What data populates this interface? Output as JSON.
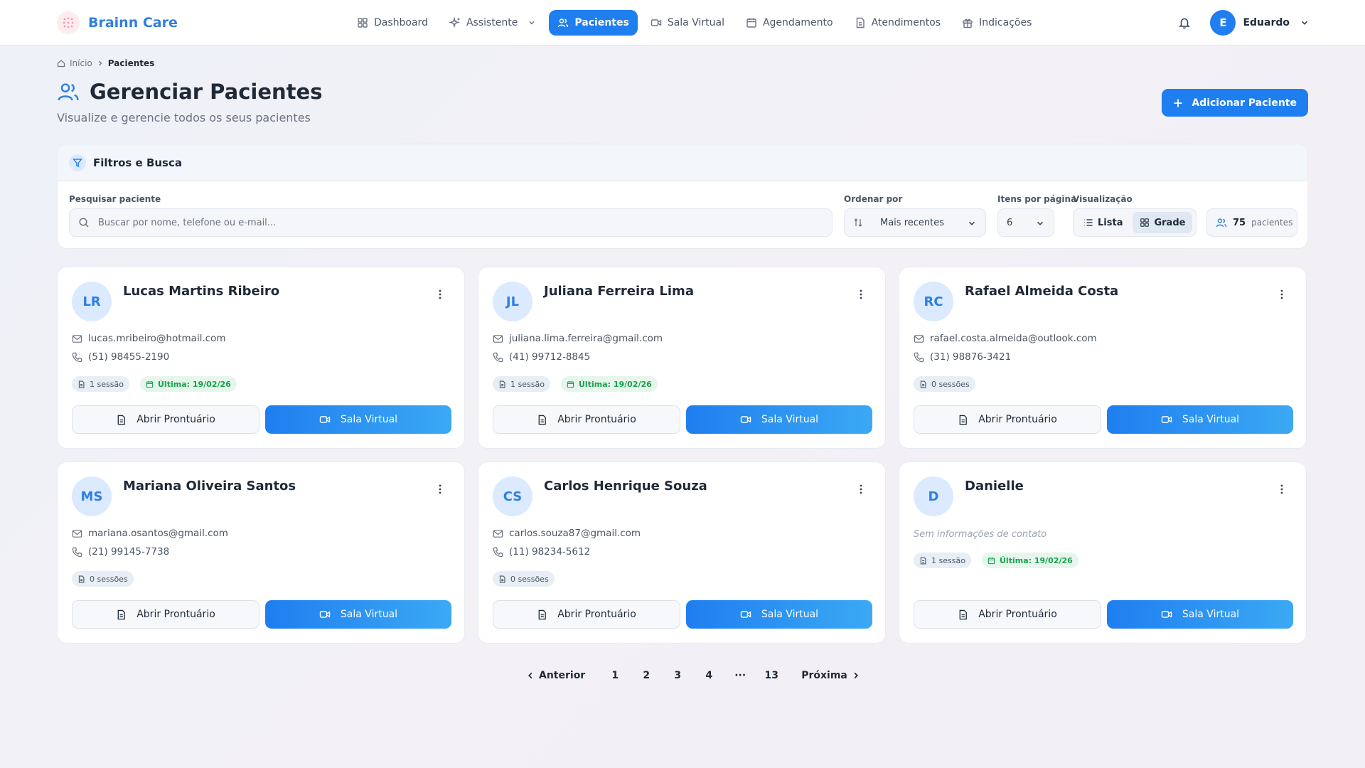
{
  "brand": {
    "name": "Brainn Care"
  },
  "nav": {
    "items": [
      {
        "label": "Dashboard",
        "icon": "grid-icon"
      },
      {
        "label": "Assistente",
        "icon": "sparkles-icon"
      },
      {
        "label": "Pacientes",
        "icon": "users-icon",
        "active": true
      },
      {
        "label": "Sala Virtual",
        "icon": "video-icon"
      },
      {
        "label": "Agendamento",
        "icon": "calendar-icon"
      },
      {
        "label": "Atendimentos",
        "icon": "document-icon"
      },
      {
        "label": "Indicações",
        "icon": "gift-icon"
      }
    ]
  },
  "user": {
    "initial": "E",
    "name": "Eduardo"
  },
  "breadcrumb": {
    "home": "Início",
    "current": "Pacientes"
  },
  "header": {
    "title": "Gerenciar Pacientes",
    "subtitle": "Visualize e gerencie todos os seus pacientes",
    "add_button": "Adicionar Paciente"
  },
  "filters": {
    "title": "Filtros e Busca",
    "search_label": "Pesquisar paciente",
    "search_placeholder": "Buscar por nome, telefone ou e-mail...",
    "order_label": "Ordenar por",
    "order_value": "Mais recentes",
    "per_page_label": "Itens por página",
    "per_page_value": "6",
    "view_label": "Visualização",
    "view_list": "Lista",
    "view_grid": "Grade",
    "count": "75",
    "count_label": "pacientes"
  },
  "card_actions": {
    "prontuario": "Abrir Prontuário",
    "sala": "Sala Virtual"
  },
  "patients": [
    {
      "initials": "LR",
      "name": "Lucas Martins Ribeiro",
      "email": "lucas.mribeiro@hotmail.com",
      "phone": "(51) 98455-2190",
      "sessions": "1 sessão",
      "last": "Última: 19/02/26"
    },
    {
      "initials": "JL",
      "name": "Juliana Ferreira Lima",
      "email": "juliana.lima.ferreira@gmail.com",
      "phone": "(41) 99712-8845",
      "sessions": "1 sessão",
      "last": "Última: 19/02/26"
    },
    {
      "initials": "RC",
      "name": "Rafael Almeida Costa",
      "email": "rafael.costa.almeida@outlook.com",
      "phone": "(31) 98876-3421",
      "sessions": "0 sessões",
      "last": ""
    },
    {
      "initials": "MS",
      "name": "Mariana Oliveira Santos",
      "email": "mariana.osantos@gmail.com",
      "phone": "(21) 99145-7738",
      "sessions": "0 sessões",
      "last": ""
    },
    {
      "initials": "CS",
      "name": "Carlos Henrique Souza",
      "email": "carlos.souza87@gmail.com",
      "phone": "(11) 98234-5612",
      "sessions": "0 sessões",
      "last": ""
    },
    {
      "initials": "D",
      "name": "Danielle",
      "empty": "Sem informações de contato",
      "sessions": "1 sessão",
      "last": "Última: 19/02/26"
    }
  ],
  "pagination": {
    "prev": "Anterior",
    "next": "Próxima",
    "pages": [
      "1",
      "2",
      "3",
      "4",
      "···",
      "13"
    ]
  }
}
